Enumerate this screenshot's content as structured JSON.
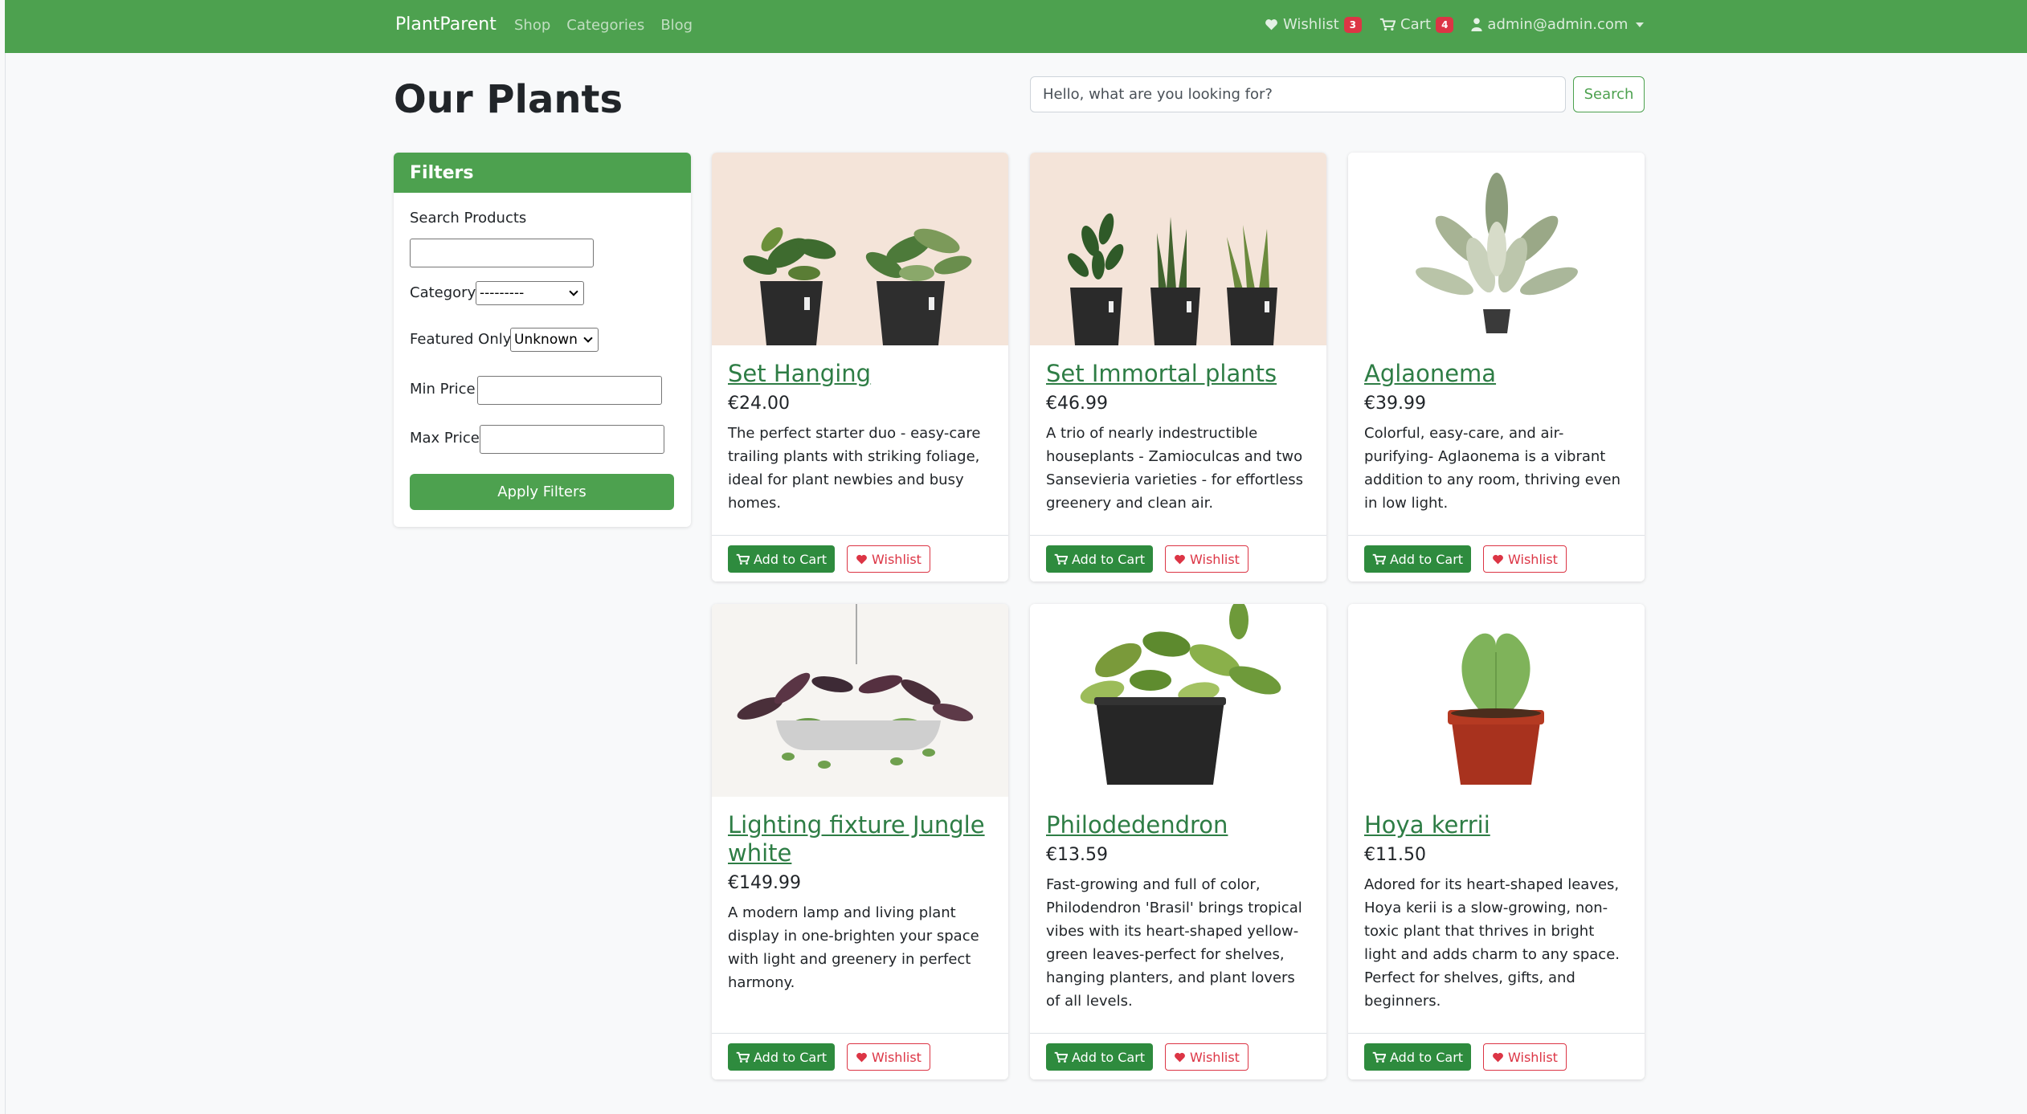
{
  "navbar": {
    "brand": "PlantParent",
    "links": [
      "Shop",
      "Categories",
      "Blog"
    ],
    "wishlist_label": "Wishlist",
    "wishlist_count": "3",
    "cart_label": "Cart",
    "cart_count": "4",
    "user_email": "admin@admin.com"
  },
  "page": {
    "title": "Our Plants",
    "search_placeholder": "Hello, what are you looking for?",
    "search_button": "Search"
  },
  "filters": {
    "header": "Filters",
    "search_label": "Search Products",
    "category_label": "Category",
    "category_value": "---------",
    "featured_label": "Featured Only",
    "featured_value": "Unknown",
    "min_price_label": "Min Price",
    "max_price_label": "Max Price",
    "apply_button": "Apply Filters"
  },
  "card_actions": {
    "add_to_cart": "Add to Cart",
    "wishlist": "Wishlist"
  },
  "products": [
    {
      "name": "Set Hanging",
      "price": "€24.00",
      "description": "The perfect starter duo - easy-care trailing plants with striking foliage, ideal for plant newbies and busy homes."
    },
    {
      "name": "Set Immortal plants",
      "price": "€46.99",
      "description": "A trio of nearly indestructible houseplants - Zamioculcas and two Sansevieria varieties - for effortless greenery and clean air."
    },
    {
      "name": "Aglaonema",
      "price": "€39.99",
      "description": "Colorful, easy-care, and air-purifying- Aglaonema is a vibrant addition to any room, thriving even in low light."
    },
    {
      "name": "Lighting fixture Jungle white",
      "price": "€149.99",
      "description": "A modern lamp and living plant display in one-brighten your space with light and greenery in perfect harmony."
    },
    {
      "name": "Philodedendron",
      "price": "€13.59",
      "description": "Fast-growing and full of color, Philodendron 'Brasil' brings tropical vibes with its heart-shaped yellow-green leaves-perfect for shelves, hanging planters, and plant lovers of all levels."
    },
    {
      "name": "Hoya kerrii",
      "price": "€11.50",
      "description": "Adored for its heart-shaped leaves, Hoya kerii is a slow-growing, non-toxic plant that thrives in bright light and adds charm to any space. Perfect for shelves, gifts, and beginners."
    }
  ],
  "colors": {
    "primary": "#4da14f",
    "cart_button": "#2e8b3e",
    "wishlist": "#dc3545",
    "title_link": "#2e7d45"
  }
}
